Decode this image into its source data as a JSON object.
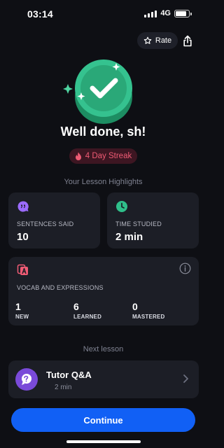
{
  "status_bar": {
    "time": "03:14",
    "network": "4G",
    "battery_level": 0.85
  },
  "header": {
    "rate_label": "Rate"
  },
  "completion": {
    "title": "Well done, sh!",
    "streak_label": "4 Day Streak"
  },
  "highlights": {
    "section_title": "Your Lesson Highlights",
    "sentences": {
      "label": "SENTENCES SAID",
      "value": "10"
    },
    "time": {
      "label": "TIME STUDIED",
      "value": "2 min"
    },
    "vocab": {
      "label": "VOCAB AND EXPRESSIONS",
      "stats": [
        {
          "value": "1",
          "label": "NEW"
        },
        {
          "value": "6",
          "label": "LEARNED"
        },
        {
          "value": "0",
          "label": "MASTERED"
        }
      ]
    }
  },
  "next_lesson": {
    "section_title": "Next lesson",
    "name": "Tutor Q&A",
    "duration": "2 min"
  },
  "continue_label": "Continue",
  "colors": {
    "background": "#0e0f14",
    "card": "#1c1e26",
    "accent_green": "#2fbf8a",
    "streak_red": "#ef5b74",
    "primary_blue": "#1160f5",
    "tutor_purple": "#7a4ad9"
  }
}
